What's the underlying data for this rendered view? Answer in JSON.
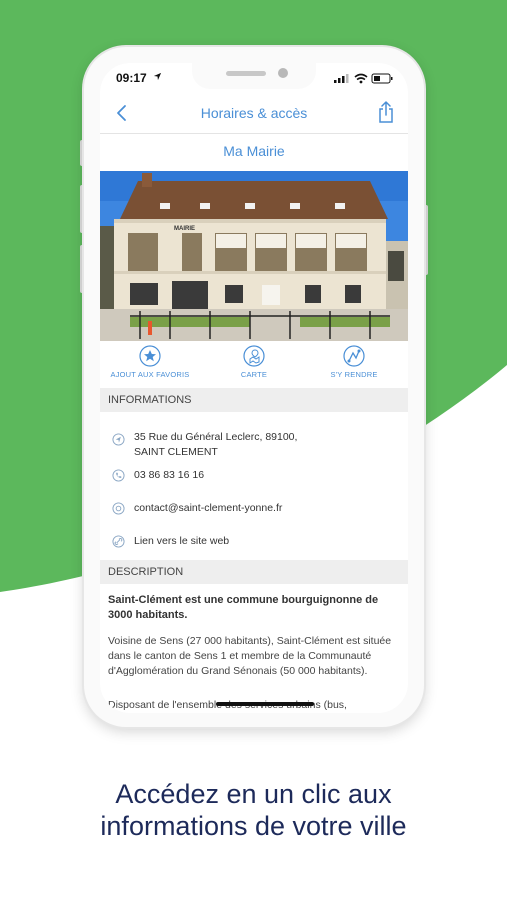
{
  "colors": {
    "green_bg": "#5cb85c",
    "accent_blue": "#4a8fd6",
    "headline_navy": "#1d2a5a"
  },
  "status_bar": {
    "time": "09:17"
  },
  "nav": {
    "title": "Horaires & accès",
    "back_icon": "chevron-left-icon",
    "share_icon": "share-icon"
  },
  "page": {
    "subtitle": "Ma Mairie"
  },
  "photo": {
    "sign_text": "MAIRIE"
  },
  "actions": [
    {
      "label": "AJOUT AUX FAVORIS",
      "icon": "star-icon"
    },
    {
      "label": "CARTE",
      "icon": "map-icon"
    },
    {
      "label": "S'Y RENDRE",
      "icon": "directions-icon"
    }
  ],
  "informations": {
    "heading": "INFORMATIONS",
    "address": "35 Rue du Général Leclerc, 89100,\nSAINT CLEMENT",
    "phone": "03 86 83 16 16",
    "email": "contact@saint-clement-yonne.fr",
    "website": "Lien vers le site web"
  },
  "description": {
    "heading": "DESCRIPTION",
    "lead": "Saint-Clément est une commune  bourguignonne de 3000 habitants.",
    "paragraph1": "Voisine de Sens (27 000 habitants), Saint-Clément est située dans le canton de Sens 1 et membre de la Communauté d'Agglomération du Grand Sénonais (50 000 habitants).",
    "paragraph2": "Disposant de l'ensemble des services urbains (bus,"
  },
  "headline": {
    "line1": "Accédez en un clic aux",
    "line2": "informations de votre ville"
  }
}
